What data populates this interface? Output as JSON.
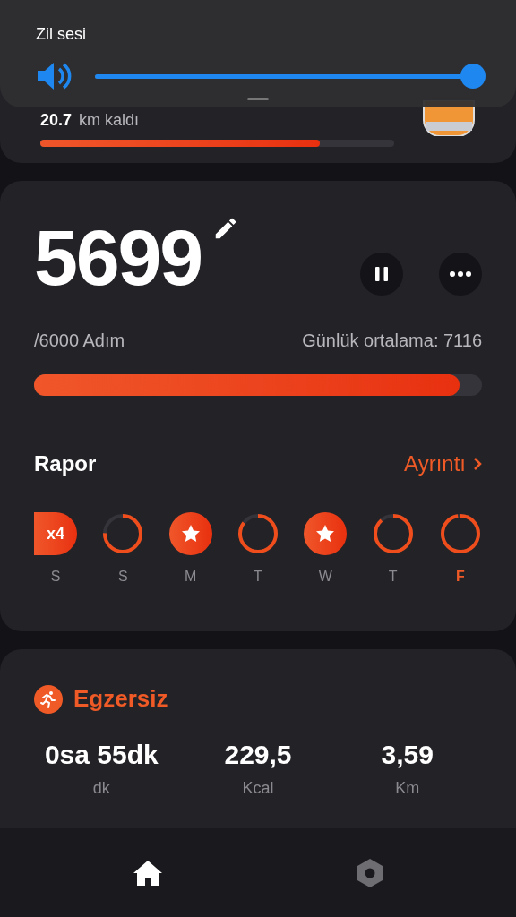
{
  "volume_panel": {
    "title": "Zil sesi",
    "level": 1
  },
  "distance_card": {
    "value": "20.7",
    "label": "km kaldı",
    "level": 0.79
  },
  "steps_card": {
    "count": "5699",
    "goal": "/6000 Adım",
    "average": "Günlük ortalama: 7116",
    "level": 0.95,
    "paused": false
  },
  "report": {
    "title": "Rapor",
    "link": "Ayrıntı",
    "days": [
      {
        "label": "S",
        "kind": "streak",
        "text": "x4",
        "selected": false
      },
      {
        "label": "S",
        "kind": "ring",
        "selected": false
      },
      {
        "label": "M",
        "kind": "star",
        "selected": false
      },
      {
        "label": "T",
        "kind": "ring",
        "selected": false
      },
      {
        "label": "W",
        "kind": "star",
        "selected": false
      },
      {
        "label": "T",
        "kind": "ring",
        "selected": false
      },
      {
        "label": "F",
        "kind": "ring",
        "selected": true
      }
    ]
  },
  "exercise": {
    "title": "Egzersiz",
    "stats": [
      {
        "value": "0sa 55dk",
        "unit": "dk"
      },
      {
        "value": "229,5",
        "unit": "Kcal"
      },
      {
        "value": "3,59",
        "unit": "Km"
      }
    ]
  },
  "nav": [
    {
      "kind": "home",
      "selected": true
    },
    {
      "kind": "settings",
      "selected": false
    }
  ]
}
